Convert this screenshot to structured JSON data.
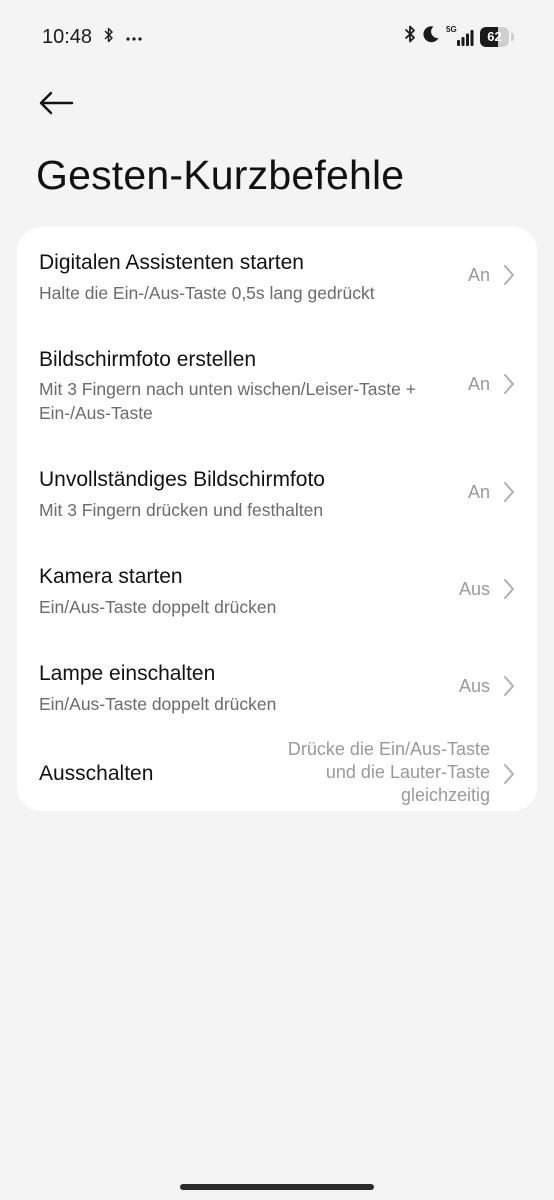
{
  "status_bar": {
    "time": "10:48",
    "network": "5G",
    "battery_level": 62,
    "battery_text": "62",
    "icons": [
      "bluetooth-icon",
      "more-dots-icon",
      "bluetooth-icon",
      "moon-icon",
      "signal-icon",
      "battery-icon"
    ]
  },
  "header": {
    "back_icon": "back-arrow-icon",
    "title": "Gesten-Kurzbefehle"
  },
  "settings": [
    {
      "title": "Digitalen Assistenten starten",
      "subtitle": "Halte die Ein-/Aus-Taste 0,5s lang gedrückt",
      "value": "An"
    },
    {
      "title": "Bildschirmfoto erstellen",
      "subtitle": "Mit 3 Fingern nach unten wischen/Leiser-Taste + Ein-/Aus-Taste",
      "value": "An"
    },
    {
      "title": "Unvollständiges Bildschirmfoto",
      "subtitle": "Mit 3 Fingern drücken und festhalten",
      "value": "An"
    },
    {
      "title": "Kamera starten",
      "subtitle": "Ein/Aus-Taste doppelt drücken",
      "value": "Aus"
    },
    {
      "title": "Lampe einschalten",
      "subtitle": "Ein/Aus-Taste doppelt drücken",
      "value": "Aus"
    },
    {
      "title": "Ausschalten",
      "value": "Drücke die Ein/Aus-Taste\nund die Lauter-Taste\ngleichzeitig"
    }
  ],
  "colors": {
    "background": "#f4f4f4",
    "card": "#ffffff",
    "title_text": "#121212",
    "subtitle_text": "#6b6b6b",
    "value_text": "#9a9a9a",
    "chevron": "#b0b0b0"
  }
}
